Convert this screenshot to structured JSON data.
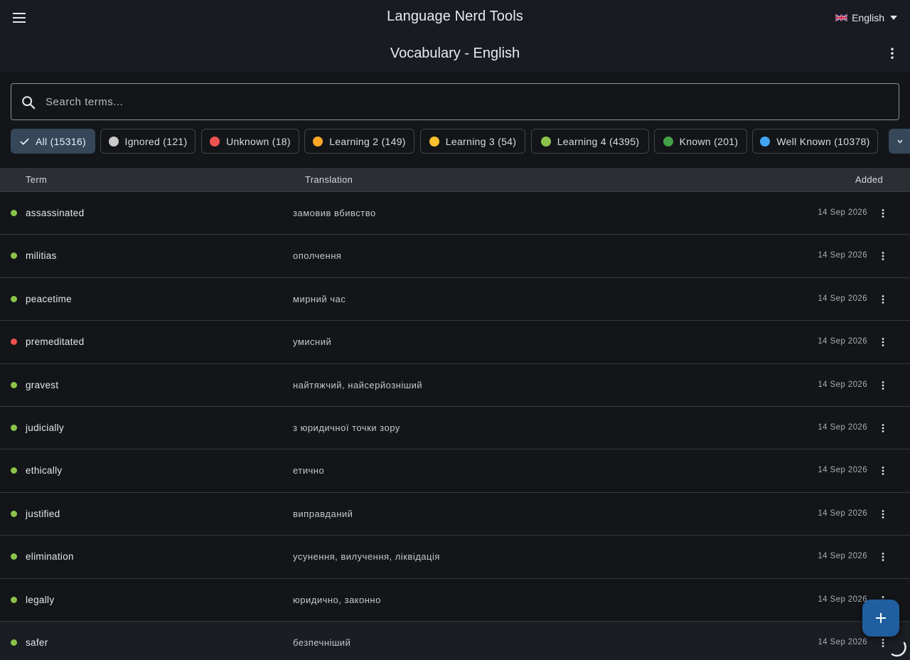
{
  "app": {
    "title": "Language Nerd Tools"
  },
  "language": {
    "label": "English",
    "flag": "uk-flag-icon"
  },
  "page": {
    "title": "Vocabulary - English",
    "menu_icon": "more-vertical-icon"
  },
  "search": {
    "placeholder": "Search terms...",
    "value": "",
    "icon": "search-icon"
  },
  "filters": [
    {
      "label": "All (15316)",
      "selected": true,
      "color": null
    },
    {
      "label": "Ignored (121)",
      "selected": false,
      "color": "#c9c9c9"
    },
    {
      "label": "Unknown (18)",
      "selected": false,
      "color": "#ef5350"
    },
    {
      "label": "Learning 2 (149)",
      "selected": false,
      "color": "#ffa726"
    },
    {
      "label": "Learning 3 (54)",
      "selected": false,
      "color": "#fbc02d"
    },
    {
      "label": "Learning 4 (4395)",
      "selected": false,
      "color": "#8bc34a"
    },
    {
      "label": "Known (201)",
      "selected": false,
      "color": "#43a047"
    },
    {
      "label": "Well Known (10378)",
      "selected": false,
      "color": "#42a5f5"
    }
  ],
  "table": {
    "headers": {
      "term": "Term",
      "translation": "Translation",
      "added": "Added"
    },
    "rows": [
      {
        "term": "assassinated",
        "translation": "замовив вбивство",
        "added": "14 Sep 2026",
        "status_color": "#8bc34a"
      },
      {
        "term": "militias",
        "translation": "ополчення",
        "added": "14 Sep 2026",
        "status_color": "#8bc34a"
      },
      {
        "term": "peacetime",
        "translation": "мирний час",
        "added": "14 Sep 2026",
        "status_color": "#8bc34a"
      },
      {
        "term": "premeditated",
        "translation": "умисний",
        "added": "14 Sep 2026",
        "status_color": "#ef5350"
      },
      {
        "term": "gravest",
        "translation": "найтяжчий, найсерйозніший",
        "added": "14 Sep 2026",
        "status_color": "#8bc34a"
      },
      {
        "term": "judicially",
        "translation": "з юридичної точки зору",
        "added": "14 Sep 2026",
        "status_color": "#8bc34a"
      },
      {
        "term": "ethically",
        "translation": "етично",
        "added": "14 Sep 2026",
        "status_color": "#8bc34a"
      },
      {
        "term": "justified",
        "translation": "виправданий",
        "added": "14 Sep 2026",
        "status_color": "#8bc34a"
      },
      {
        "term": "elimination",
        "translation": "усунення, вилучення, ліквідація",
        "added": "14 Sep 2026",
        "status_color": "#8bc34a"
      },
      {
        "term": "legally",
        "translation": "юридично, законно",
        "added": "14 Sep 2026",
        "status_color": "#8bc34a"
      },
      {
        "term": "safer",
        "translation": "безпечніший",
        "added": "14 Sep 2026",
        "status_color": "#8bc34a"
      }
    ]
  },
  "fab": {
    "icon": "plus-icon"
  },
  "colors": {
    "accent": "#1f5fa0",
    "selected_chip": "#36475a",
    "background": "#131519"
  }
}
